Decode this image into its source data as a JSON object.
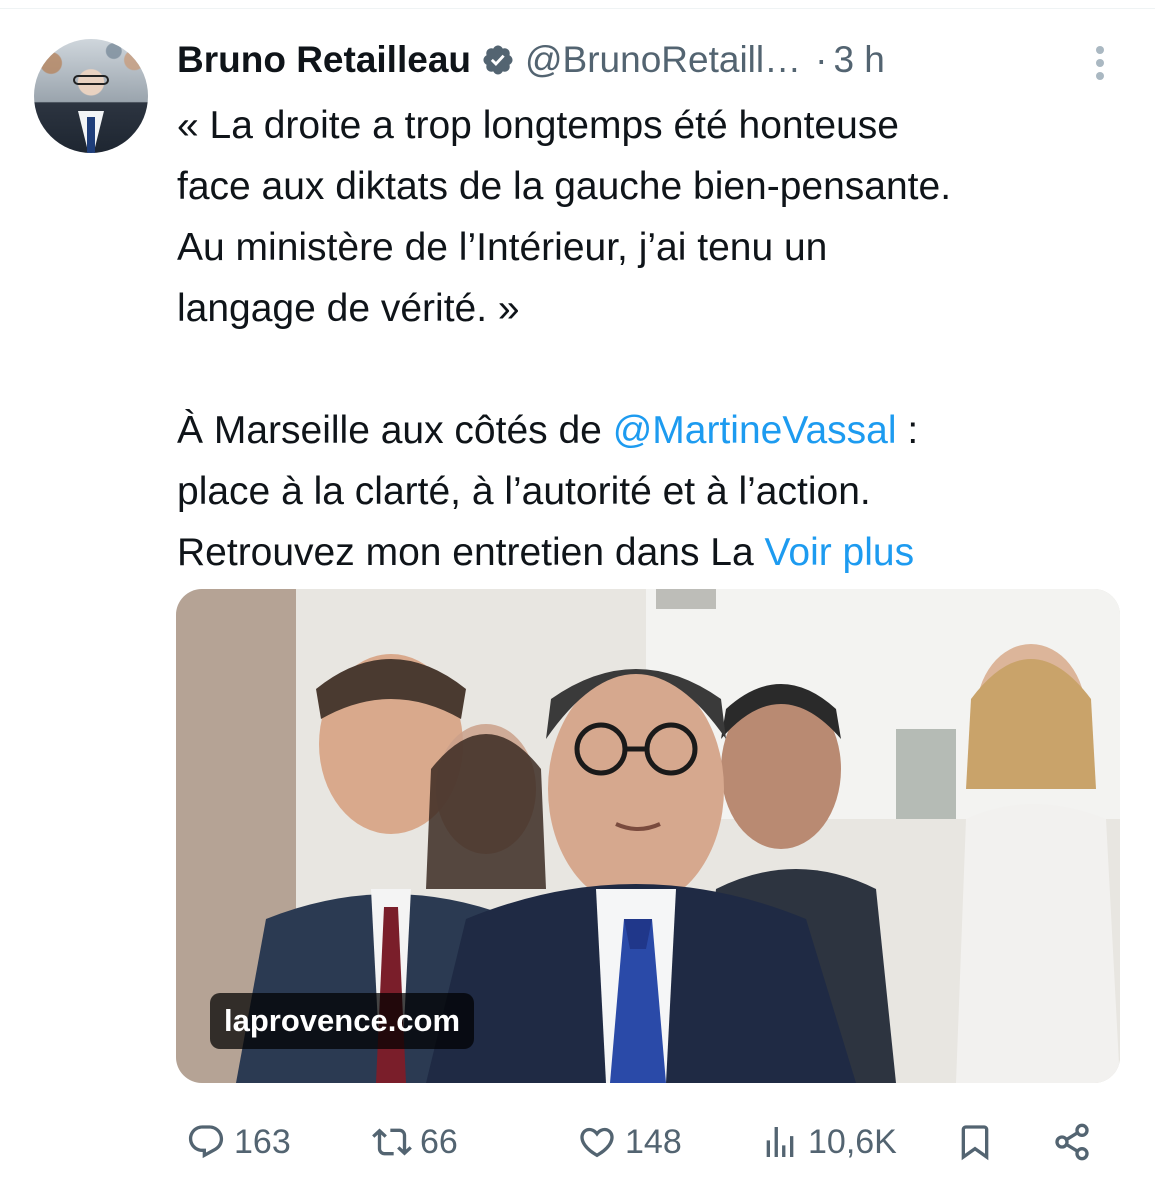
{
  "author": {
    "name": "Bruno Retailleau",
    "handle": "@BrunoRetaill…",
    "separator": "·",
    "time": "3 h",
    "verified_icon": "verified-badge-icon",
    "verified_color": "#536471"
  },
  "tweet": {
    "line1": "« La droite a trop longtemps été honteuse",
    "line2": "face aux diktats de la gauche bien-pensante.",
    "line3": "Au ministère de l’Intérieur, j’ai tenu un",
    "line4": "langage de vérité. »",
    "line5_prefix": "À Marseille aux côtés de ",
    "mention": "@MartineVassal",
    "line5_suffix": " :",
    "line6": "place à la clarté, à l’autorité et à l’action.",
    "line7_prefix": "Retrouvez mon entretien dans La ",
    "see_more": "Voir plus"
  },
  "card": {
    "domain": "laprovence.com"
  },
  "actions": {
    "replies": "163",
    "retweets": "66",
    "likes": "148",
    "views": "10,6K"
  },
  "colors": {
    "link": "#1d9bf0",
    "secondary": "#536471",
    "text": "#0f1419"
  }
}
